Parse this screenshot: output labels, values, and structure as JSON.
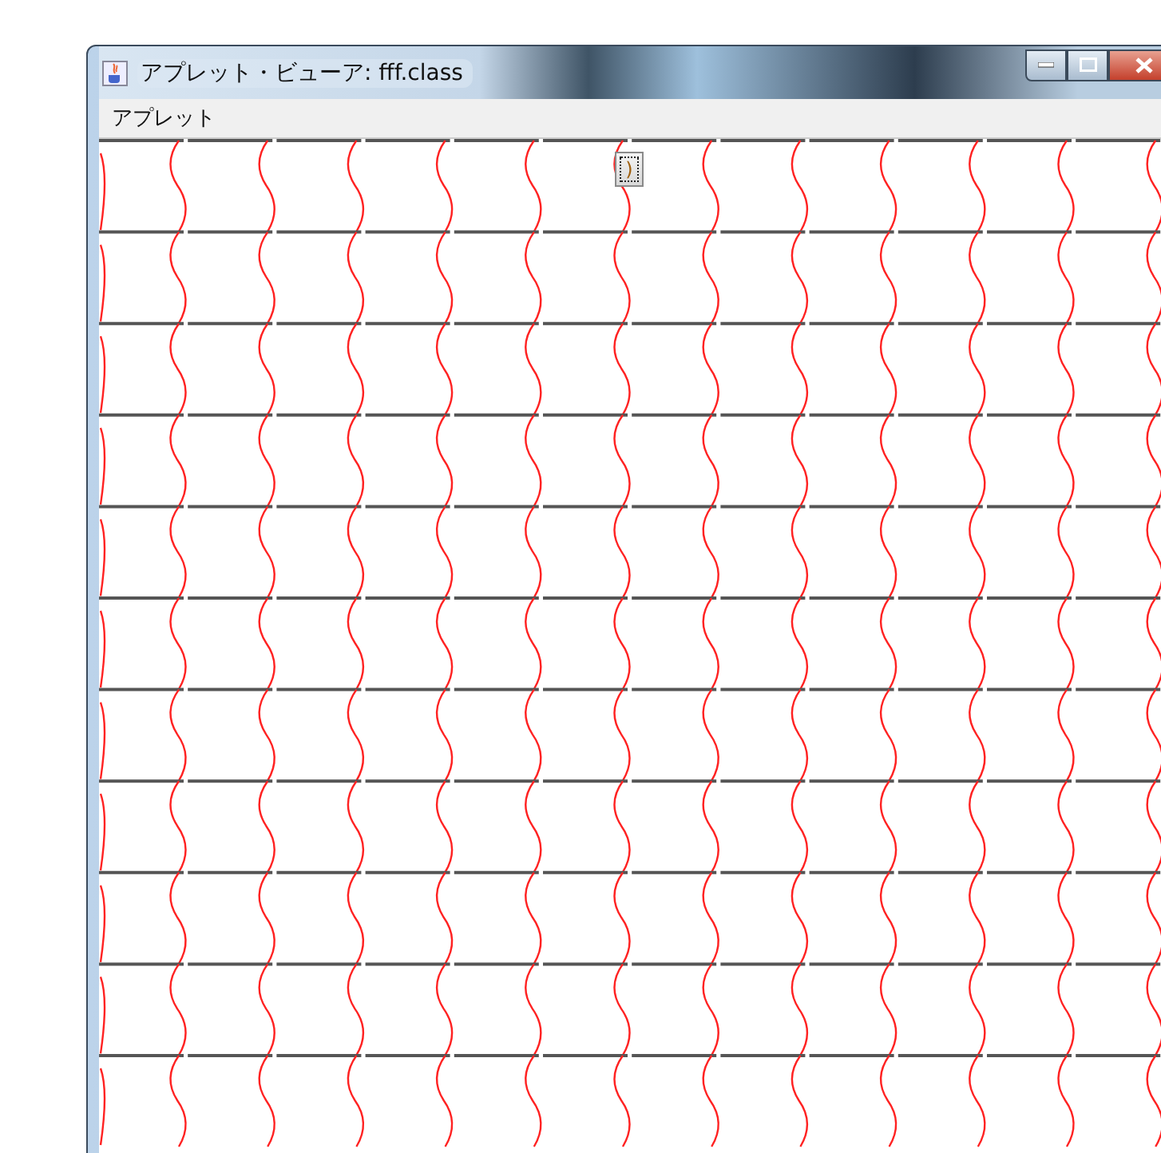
{
  "window": {
    "title": "アプレット・ビューア: fff.class"
  },
  "menu_bar": {
    "items": [
      {
        "label": "アプレット"
      }
    ]
  },
  "applet": {
    "button": {
      "label": ")"
    }
  }
}
